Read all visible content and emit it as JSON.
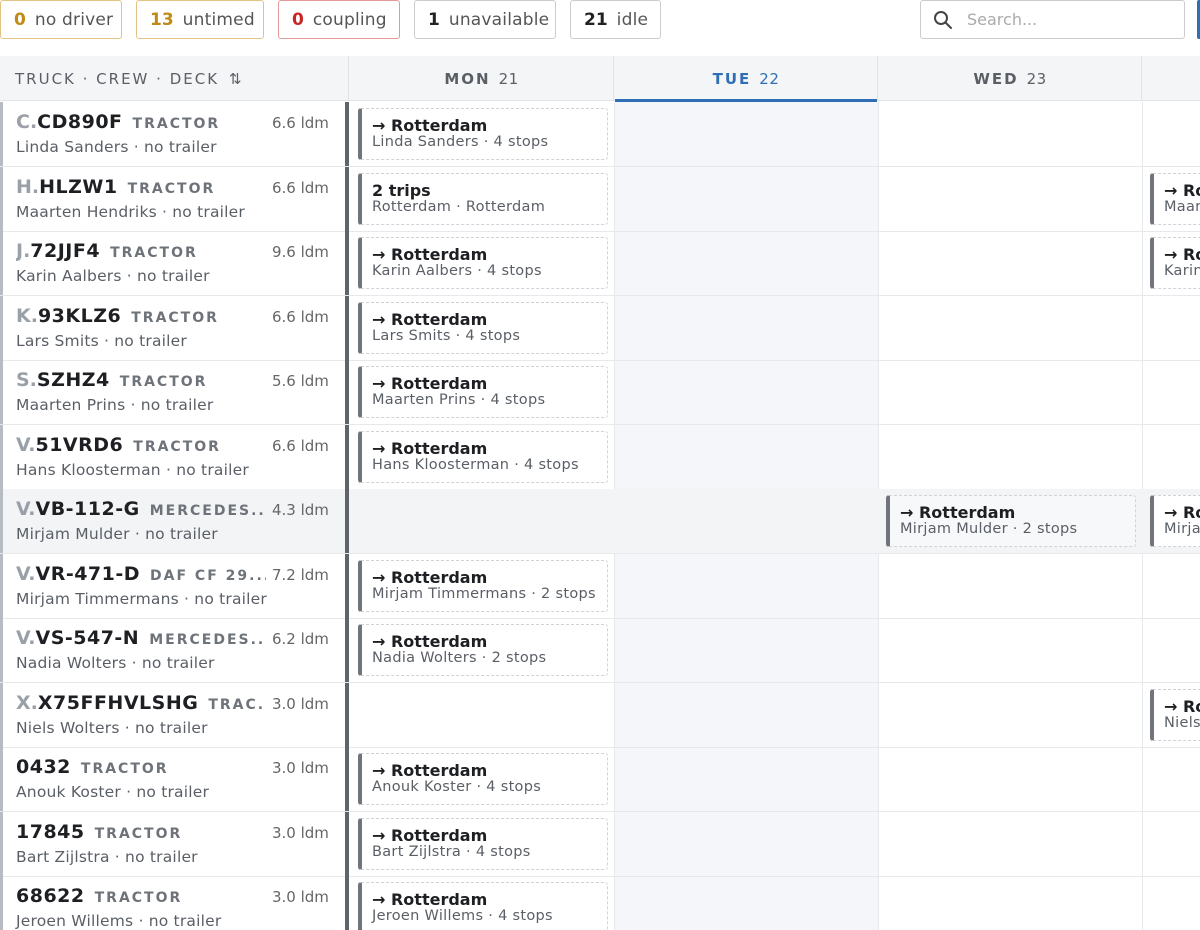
{
  "filters": [
    {
      "count": "0",
      "label": "no driver",
      "tone": "warn",
      "color": "#c08a16"
    },
    {
      "count": "13",
      "label": "untimed",
      "tone": "warn",
      "color": "#c08a16"
    },
    {
      "count": "0",
      "label": "coupling",
      "tone": "alert",
      "color": "#c62828"
    },
    {
      "count": "1",
      "label": "unavailable",
      "tone": "plain",
      "color": "#222222"
    },
    {
      "count": "21",
      "label": "idle",
      "tone": "plain",
      "color": "#222222"
    }
  ],
  "search": {
    "placeholder": "Search..."
  },
  "header": {
    "truck_col": "TRUCK · CREW · DECK",
    "sort_icon": "⇅",
    "days": [
      {
        "name": "MON",
        "date": "21",
        "today": false
      },
      {
        "name": "TUE",
        "date": "22",
        "today": true
      },
      {
        "name": "WED",
        "date": "23",
        "today": false
      },
      {
        "name": "",
        "date": "",
        "today": false
      }
    ]
  },
  "accent_color": "#2f6db5",
  "rows": [
    {
      "prefix": "C.",
      "plate": "CD890F",
      "type": "TRACTOR",
      "ldm": "6.6 ldm",
      "crew": "Linda Sanders · no trailer",
      "mon": {
        "title": "→ Rotterdam",
        "sub": "Linda Sanders · 4 stops"
      }
    },
    {
      "prefix": "H.",
      "plate": "HLZW1",
      "type": "TRACTOR",
      "ldm": "6.6 ldm",
      "crew": "Maarten Hendriks · no trailer",
      "mon": {
        "title": "2 trips",
        "sub": "Rotterdam · Rotterdam"
      },
      "thu": {
        "title": "→ Ro",
        "sub": "Maart"
      }
    },
    {
      "prefix": "J.",
      "plate": "72JJF4",
      "type": "TRACTOR",
      "ldm": "9.6 ldm",
      "crew": "Karin Aalbers · no trailer",
      "mon": {
        "title": "→ Rotterdam",
        "sub": "Karin Aalbers · 4 stops"
      },
      "thu": {
        "title": "→ Ro",
        "sub": "Karin"
      }
    },
    {
      "prefix": "K.",
      "plate": "93KLZ6",
      "type": "TRACTOR",
      "ldm": "6.6 ldm",
      "crew": "Lars Smits · no trailer",
      "mon": {
        "title": "→ Rotterdam",
        "sub": "Lars Smits · 4 stops"
      }
    },
    {
      "prefix": "S.",
      "plate": "SZHZ4",
      "type": "TRACTOR",
      "ldm": "5.6 ldm",
      "crew": "Maarten Prins · no trailer",
      "mon": {
        "title": "→ Rotterdam",
        "sub": "Maarten Prins · 4 stops"
      }
    },
    {
      "prefix": "V.",
      "plate": "51VRD6",
      "type": "TRACTOR",
      "ldm": "6.6 ldm",
      "crew": "Hans Kloosterman · no trailer",
      "mon": {
        "title": "→ Rotterdam",
        "sub": "Hans Kloosterman · 4 stops"
      }
    },
    {
      "prefix": "V.",
      "plate": "VB-112-G",
      "type": "MERCEDES...",
      "ldm": "4.3 ldm",
      "crew": "Mirjam Mulder · no trailer",
      "highlight": true,
      "wed": {
        "title": "→ Rotterdam",
        "sub": "Mirjam Mulder · 2 stops"
      },
      "thu": {
        "title": "→ Ro",
        "sub": "Mirjan"
      }
    },
    {
      "prefix": "V.",
      "plate": "VR-471-D",
      "type": "DAF CF 29...",
      "ldm": "7.2 ldm",
      "crew": "Mirjam Timmermans · no trailer",
      "mon": {
        "title": "→ Rotterdam",
        "sub": "Mirjam Timmermans · 2 stops"
      }
    },
    {
      "prefix": "V.",
      "plate": "VS-547-N",
      "type": "MERCEDES...",
      "ldm": "6.2 ldm",
      "crew": "Nadia Wolters · no trailer",
      "mon": {
        "title": "→ Rotterdam",
        "sub": "Nadia Wolters · 2 stops"
      }
    },
    {
      "prefix": "X.",
      "plate": "X75FFHVLSHG",
      "type": "TRAC...",
      "ldm": "3.0 ldm",
      "crew": "Niels Wolters · no trailer",
      "thu": {
        "title": "→ Ro",
        "sub": "Niels"
      }
    },
    {
      "prefix": "",
      "plate": "0432",
      "type": "TRACTOR",
      "ldm": "3.0 ldm",
      "crew": "Anouk Koster · no trailer",
      "mon": {
        "title": "→ Rotterdam",
        "sub": "Anouk Koster · 4 stops"
      }
    },
    {
      "prefix": "",
      "plate": "17845",
      "type": "TRACTOR",
      "ldm": "3.0 ldm",
      "crew": "Bart Zijlstra · no trailer",
      "mon": {
        "title": "→ Rotterdam",
        "sub": "Bart Zijlstra · 4 stops"
      }
    },
    {
      "prefix": "",
      "plate": "68622",
      "type": "TRACTOR",
      "ldm": "3.0 ldm",
      "crew": "Jeroen Willems · no trailer",
      "mon": {
        "title": "→ Rotterdam",
        "sub": "Jeroen Willems · 4 stops"
      }
    }
  ]
}
